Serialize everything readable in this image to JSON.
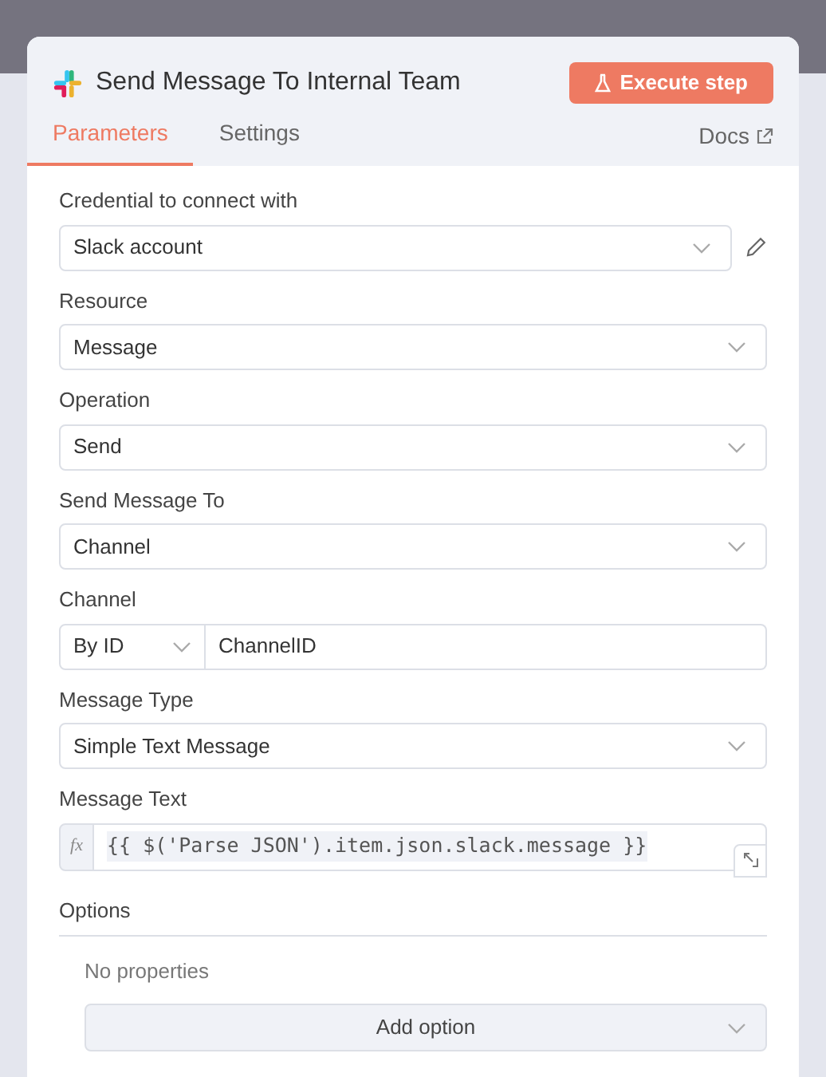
{
  "panel": {
    "title": "Send Message To Internal Team",
    "execute_button": "Execute step"
  },
  "tabs": [
    {
      "label": "Parameters",
      "selected": true
    },
    {
      "label": "Settings",
      "selected": false
    }
  ],
  "docs_link": "Docs",
  "fields": [
    {
      "kind": "select",
      "label": "Credential to connect with",
      "value": "Slack account",
      "editable": true
    },
    {
      "kind": "select",
      "label": "Resource",
      "value": "Message",
      "editable": false
    },
    {
      "kind": "select",
      "label": "Operation",
      "value": "Send",
      "editable": false
    },
    {
      "kind": "select",
      "label": "Send Message To",
      "value": "Channel",
      "editable": false
    },
    {
      "kind": "mode_input",
      "label": "Channel",
      "mode": "By ID",
      "value": "ChannelID"
    },
    {
      "kind": "select",
      "label": "Message Type",
      "value": "Simple Text Message",
      "editable": false
    },
    {
      "kind": "expression",
      "label": "Message Text",
      "prefix": "fx",
      "value": "{{ $('Parse JSON').item.json.slack.message }}"
    }
  ],
  "options": {
    "heading": "Options",
    "empty_text": "No properties",
    "add_button": "Add option"
  }
}
